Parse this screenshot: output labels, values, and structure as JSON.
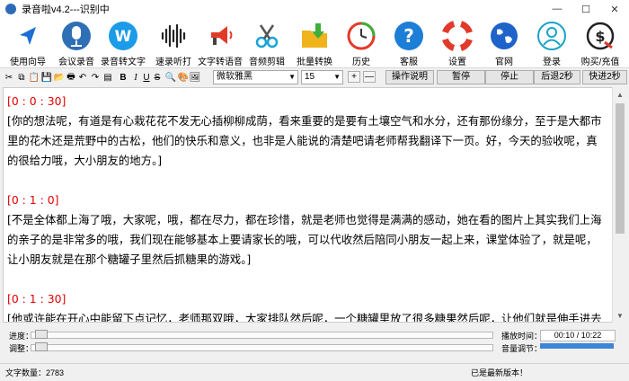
{
  "window": {
    "title": "录音啦v4.2---识别中",
    "min_glyph": "—",
    "max_glyph": "☐",
    "close_glyph": "✕"
  },
  "toolbar": {
    "items": [
      {
        "label": "使用向导",
        "icon": "navigation-arrow-icon"
      },
      {
        "label": "会议录音",
        "icon": "microphone-icon"
      },
      {
        "label": "录音转文字",
        "icon": "w-letter-icon"
      },
      {
        "label": "速录听打",
        "icon": "sound-wave-icon"
      },
      {
        "label": "文字转语音",
        "icon": "megaphone-icon"
      },
      {
        "label": "音频剪辑",
        "icon": "scissors-icon"
      },
      {
        "label": "批量转换",
        "icon": "folder-arrow-icon"
      },
      {
        "label": "历史",
        "icon": "history-clock-icon"
      },
      {
        "label": "客服",
        "icon": "question-icon"
      },
      {
        "label": "设置",
        "icon": "lifebuoy-icon"
      },
      {
        "label": "官网",
        "icon": "globe-icon"
      },
      {
        "label": "登录",
        "icon": "user-icon"
      },
      {
        "label": "购买/充值",
        "icon": "dollar-icon"
      }
    ]
  },
  "format": {
    "bold": "B",
    "italic": "I",
    "underline": "U",
    "strike": "S",
    "font_name": "微软雅黑",
    "font_size": "15",
    "plus": "+",
    "minus": "—",
    "buttons": [
      "操作说明",
      "暂停",
      "停止",
      "后退2秒",
      "快进2秒"
    ]
  },
  "transcript": [
    {
      "time": "[0 : 0 : 30]",
      "text": "[你的想法呢，有道是有心栽花花不发无心插柳柳成荫，看来重要的是要有土壤空气和水分，还有那份缘分，至于是大都市里的花木还是荒野中的古松，他们的快乐和意义，也非是人能说的清楚吧请老师帮我翻译下一页。好，今天的验收呢，真的很给力哦，大小朋友的地方。]"
    },
    {
      "time": "[0 : 1 : 0]",
      "text": "[不是全体都上海了哦，大家呢，哦，都在尽力，都在珍惜，就是老师也觉得是满满的感动，她在看的图片上其实我们上海的亲子的是非常多的哦，我们现在能够基本上要请家长的哦，可以代收然后陪同小朋友一起上来，课堂体验了，就是呢，让小朋友就是在那个糖罐子里然后抓糖果的游戏。]"
    },
    {
      "time": "[0 : 1 : 30]",
      "text": "[他或许能在开心中能留下点记忆，老师那双哦，大家排队然后呢，一个糖罐里放了很多糖果然后呢，让他们就是伸手进去"
    }
  ],
  "playback": {
    "progress_label": "进度：",
    "adjust_label": "调整：",
    "play_time_label": "播放时间：",
    "volume_label": "音量调节：",
    "time_value": "00:10 / 10:22",
    "progress": 0.016,
    "adjust": 0.016,
    "volume": 1.0
  },
  "status": {
    "word_count": "文字数量：2783",
    "version_msg": "已是最新版本！"
  }
}
